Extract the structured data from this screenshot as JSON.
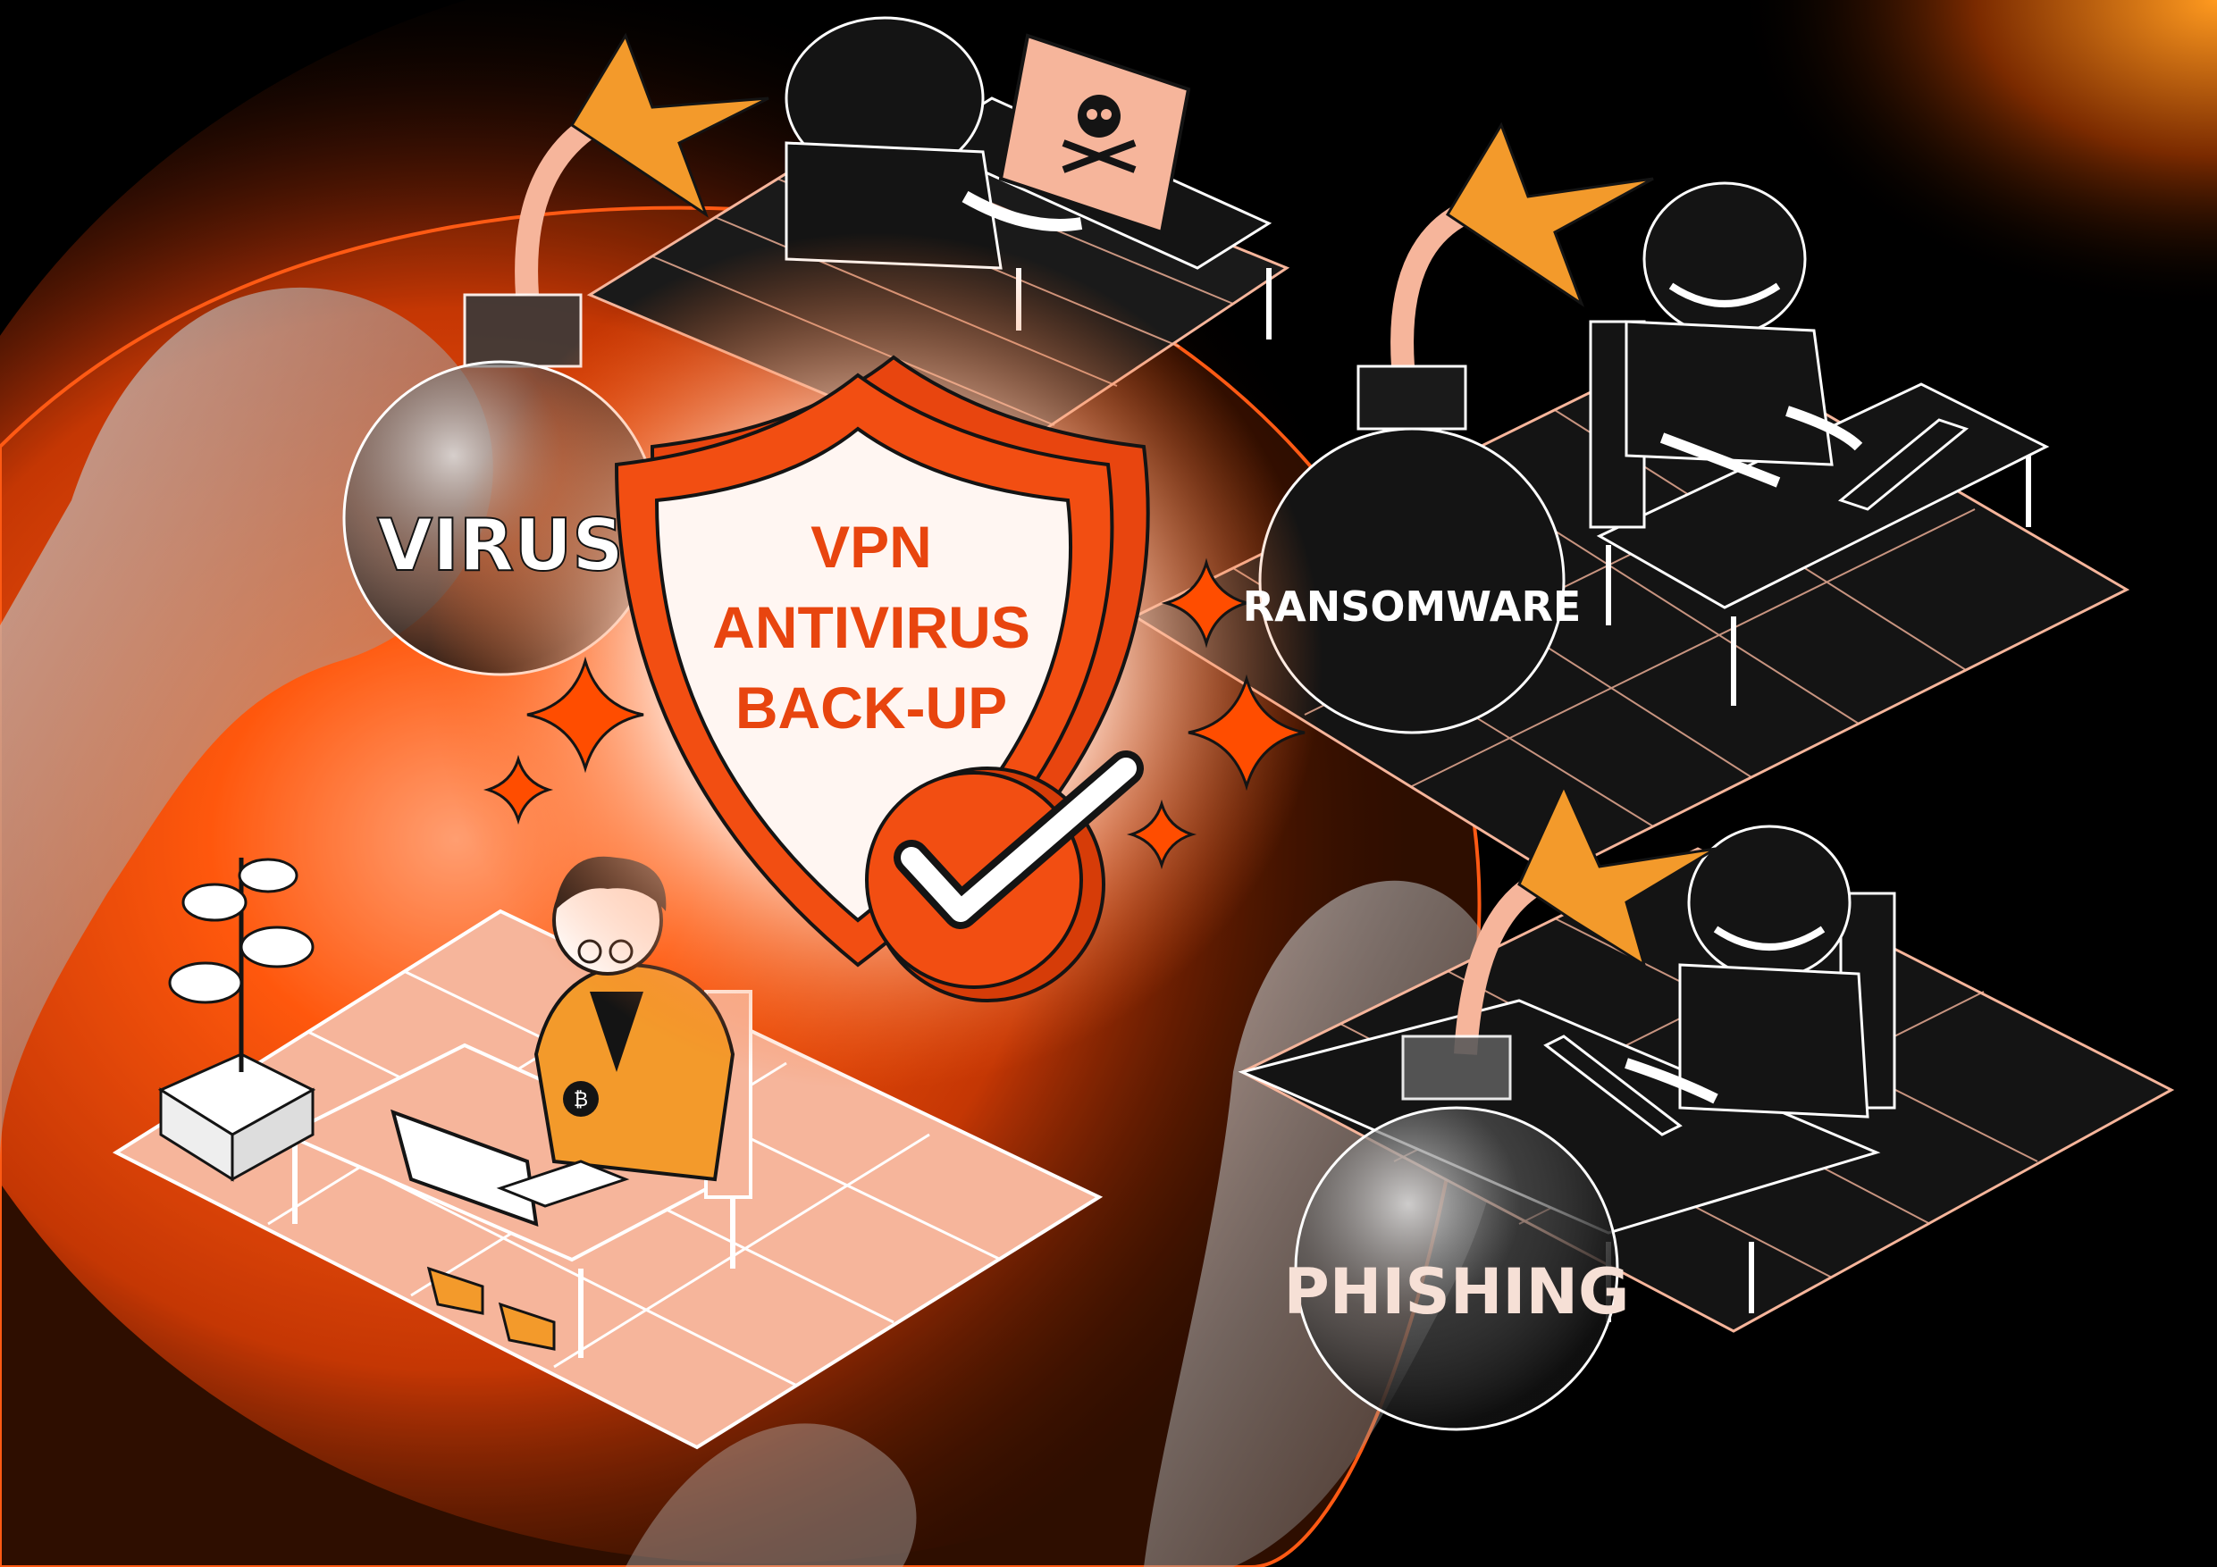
{
  "illustration": {
    "shield": {
      "lines": [
        "VPN",
        "ANTIVIRUS",
        "BACK-UP"
      ],
      "text_color": "#e8450f"
    },
    "threats": {
      "virus": "VIRUS",
      "ransomware": "RANSOMWARE",
      "phishing": "PHISHING"
    },
    "colors": {
      "accent": "#ff4d00",
      "dark": "#141414",
      "peach": "#f6b59b",
      "jacket": "#f39a2b",
      "background": "#000000"
    },
    "icons": [
      "bomb-icon",
      "shield-icon",
      "checkmark-icon",
      "skull-icon",
      "sparkle-icon",
      "plant-icon",
      "laptop-icon",
      "bitcoin-icon"
    ]
  }
}
